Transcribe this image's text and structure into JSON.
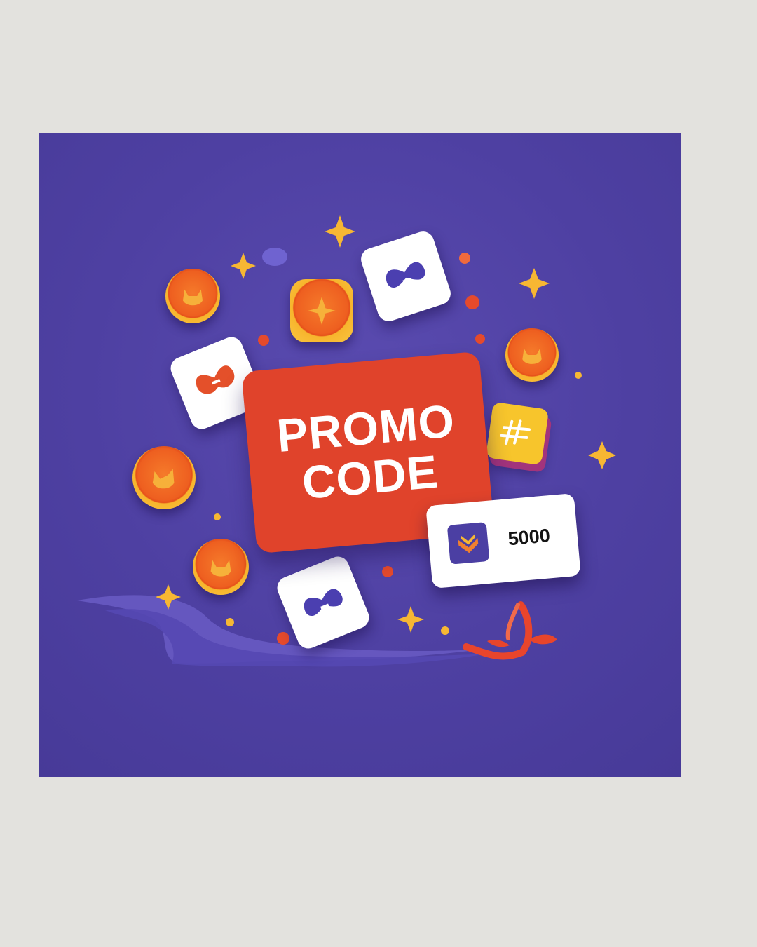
{
  "promo": {
    "line1": "PROMO",
    "line2": "CODE"
  },
  "amount": {
    "value": "5000",
    "icon": "chevron-emblem-icon"
  },
  "icons": {
    "coin": "fox-coin-icon",
    "tile": "bow-tie-tile-icon",
    "gold_tile": "hash-glyph-icon",
    "sparkle": "sparkle-star-icon",
    "ribbon": "ribbon-icon"
  },
  "colors": {
    "background": "#e3e2de",
    "panel": "#4e40a2",
    "promo_card": "#e0432b",
    "coin_orange": "#ee5f20",
    "coin_gold": "#f9c540",
    "tile_white": "#ffffff",
    "tile_orange_glyph": "#e4502a",
    "tile_purple_glyph": "#4b3fb0",
    "sparkle_gold": "#f7b733"
  }
}
